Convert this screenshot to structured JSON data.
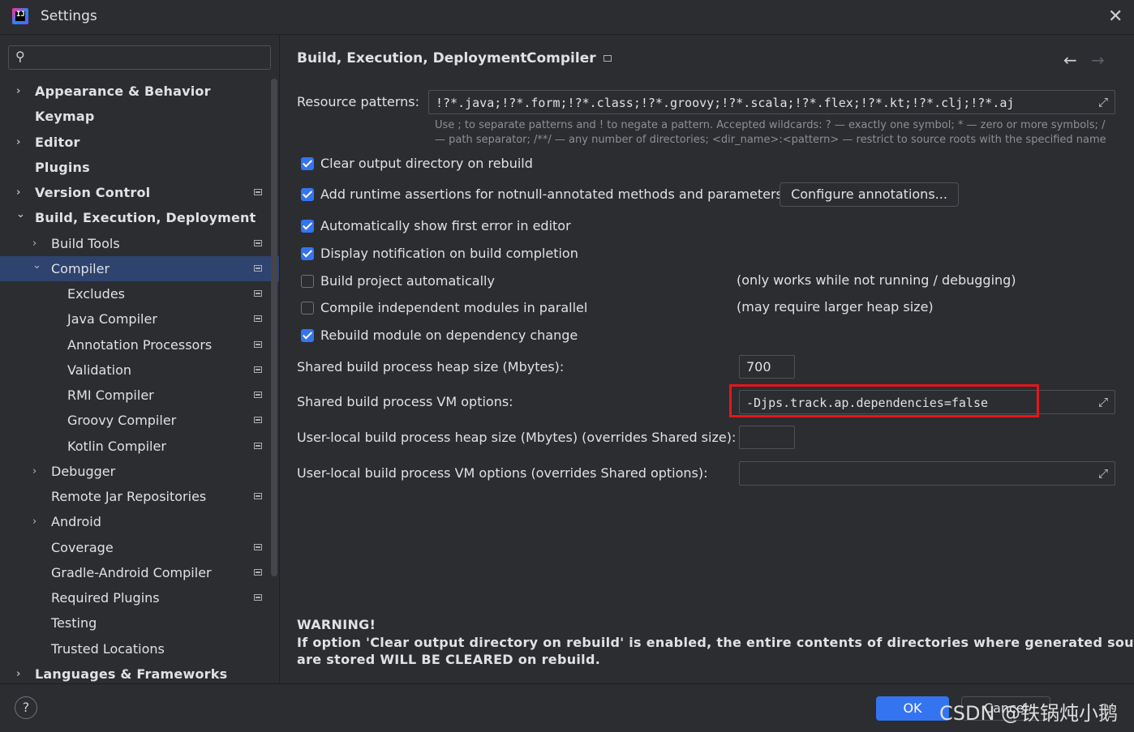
{
  "window": {
    "title": "Settings"
  },
  "search": {
    "placeholder": ""
  },
  "tree": [
    {
      "label": "Appearance & Behavior",
      "bold": true,
      "indent": 0,
      "chevron": "right",
      "page_icon": false
    },
    {
      "label": "Keymap",
      "bold": true,
      "indent": 0,
      "chevron": "",
      "page_icon": false
    },
    {
      "label": "Editor",
      "bold": true,
      "indent": 0,
      "chevron": "right",
      "page_icon": false
    },
    {
      "label": "Plugins",
      "bold": true,
      "indent": 0,
      "chevron": "",
      "page_icon": false
    },
    {
      "label": "Version Control",
      "bold": true,
      "indent": 0,
      "chevron": "right",
      "page_icon": true
    },
    {
      "label": "Build, Execution, Deployment",
      "bold": true,
      "indent": 0,
      "chevron": "down",
      "page_icon": false
    },
    {
      "label": "Build Tools",
      "bold": false,
      "indent": 1,
      "chevron": "right",
      "page_icon": true
    },
    {
      "label": "Compiler",
      "bold": false,
      "indent": 1,
      "chevron": "down",
      "page_icon": true,
      "selected": true
    },
    {
      "label": "Excludes",
      "bold": false,
      "indent": 2,
      "chevron": "",
      "page_icon": true
    },
    {
      "label": "Java Compiler",
      "bold": false,
      "indent": 2,
      "chevron": "",
      "page_icon": true
    },
    {
      "label": "Annotation Processors",
      "bold": false,
      "indent": 2,
      "chevron": "",
      "page_icon": true
    },
    {
      "label": "Validation",
      "bold": false,
      "indent": 2,
      "chevron": "",
      "page_icon": true
    },
    {
      "label": "RMI Compiler",
      "bold": false,
      "indent": 2,
      "chevron": "",
      "page_icon": true
    },
    {
      "label": "Groovy Compiler",
      "bold": false,
      "indent": 2,
      "chevron": "",
      "page_icon": true
    },
    {
      "label": "Kotlin Compiler",
      "bold": false,
      "indent": 2,
      "chevron": "",
      "page_icon": true
    },
    {
      "label": "Debugger",
      "bold": false,
      "indent": 1,
      "chevron": "right",
      "page_icon": false
    },
    {
      "label": "Remote Jar Repositories",
      "bold": false,
      "indent": 1,
      "chevron": "",
      "page_icon": true
    },
    {
      "label": "Android",
      "bold": false,
      "indent": 1,
      "chevron": "right",
      "page_icon": false
    },
    {
      "label": "Coverage",
      "bold": false,
      "indent": 1,
      "chevron": "",
      "page_icon": true
    },
    {
      "label": "Gradle-Android Compiler",
      "bold": false,
      "indent": 1,
      "chevron": "",
      "page_icon": true
    },
    {
      "label": "Required Plugins",
      "bold": false,
      "indent": 1,
      "chevron": "",
      "page_icon": true
    },
    {
      "label": "Testing",
      "bold": false,
      "indent": 1,
      "chevron": "",
      "page_icon": false
    },
    {
      "label": "Trusted Locations",
      "bold": false,
      "indent": 1,
      "chevron": "",
      "page_icon": false
    },
    {
      "label": "Languages & Frameworks",
      "bold": true,
      "indent": 0,
      "chevron": "right",
      "page_icon": false
    }
  ],
  "breadcrumb": {
    "parent": "Build, Execution, Deployment",
    "separator": "›",
    "current": "Compiler"
  },
  "nav": {
    "back": "←",
    "forward": "→"
  },
  "resource": {
    "label": "Resource patterns:",
    "value": "!?*.java;!?*.form;!?*.class;!?*.groovy;!?*.scala;!?*.flex;!?*.kt;!?*.clj;!?*.aj",
    "hint_line1": "Use ; to separate patterns and ! to negate a pattern. Accepted wildcards: ? — exactly one symbol; * — zero or more symbols; /",
    "hint_line2": "— path separator; /**/ — any number of directories; <dir_name>:<pattern> — restrict to source roots with the specified name"
  },
  "options": [
    {
      "label": "Clear output directory on rebuild",
      "checked": true,
      "note": ""
    },
    {
      "label": "Add runtime assertions for notnull-annotated methods and parameters",
      "checked": true,
      "note": ""
    },
    {
      "label": "Automatically show first error in editor",
      "checked": true,
      "note": ""
    },
    {
      "label": "Display notification on build completion",
      "checked": true,
      "note": ""
    },
    {
      "label": "Build project automatically",
      "checked": false,
      "note": "(only works while not running / debugging)"
    },
    {
      "label": "Compile independent modules in parallel",
      "checked": false,
      "note": "(may require larger heap size)"
    },
    {
      "label": "Rebuild module on dependency change",
      "checked": true,
      "note": ""
    }
  ],
  "configure_button": "Configure annotations...",
  "heap": {
    "label": "Shared build process heap size (Mbytes):",
    "value": "700"
  },
  "vm": {
    "label": "Shared build process VM options:",
    "value": "-Djps.track.ap.dependencies=false"
  },
  "user_heap": {
    "label": "User-local build process heap size (Mbytes) (overrides Shared size):",
    "value": ""
  },
  "user_vm": {
    "label": "User-local build process VM options (overrides Shared options):",
    "value": ""
  },
  "warning": {
    "title": "WARNING!",
    "line1": "If option 'Clear output directory on rebuild' is enabled, the entire contents of directories where generated sources",
    "line2": "are stored WILL BE CLEARED on rebuild."
  },
  "footer": {
    "help": "?",
    "ok": "OK",
    "cancel": "Cancel"
  },
  "watermark": "CSDN @铁锅炖小鹅",
  "colors": {
    "accent": "#3574f0",
    "highlight_box": "#e5161c",
    "selection": "#2e436e"
  }
}
